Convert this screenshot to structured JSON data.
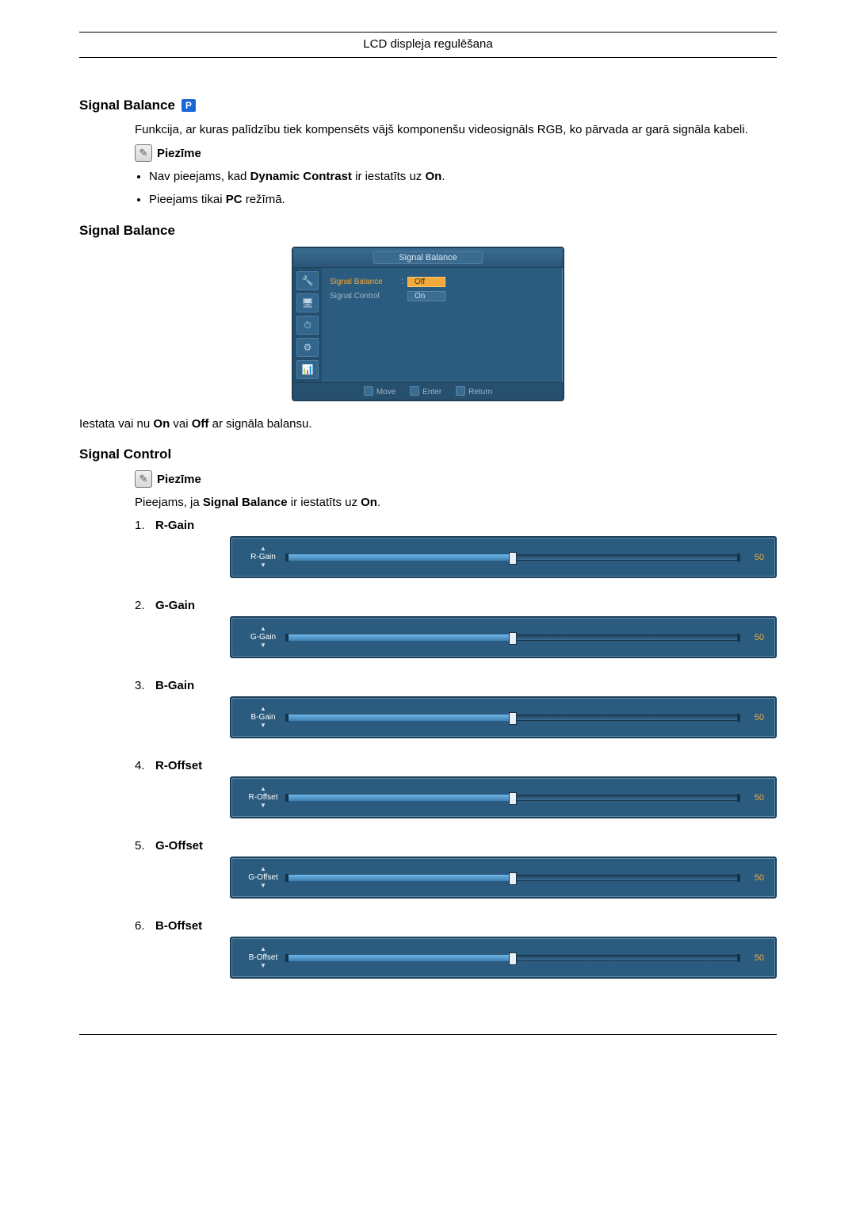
{
  "header": {
    "title": "LCD displeja regulēšana"
  },
  "sections": {
    "signal_balance_intro": {
      "heading": "Signal Balance",
      "pc_badge": "P",
      "description": "Funkcija, ar kuras palīdzību tiek kompensēts vājš komponenšu videosignāls RGB, ko pārvada ar garā signāla kabeli.",
      "note_label": "Piezīme",
      "bullets": [
        {
          "pre": "Nav pieejams, kad ",
          "bold": "Dynamic Contrast",
          "mid": " ir iestatīts uz ",
          "bold2": "On",
          "post": "."
        },
        {
          "pre": "Pieejams tikai ",
          "bold": "PC",
          "mid": " režīmā.",
          "bold2": "",
          "post": ""
        }
      ]
    },
    "signal_balance_menu": {
      "heading": "Signal Balance",
      "caption_pre": "Iestata vai nu ",
      "caption_b1": "On",
      "caption_mid": " vai ",
      "caption_b2": "Off",
      "caption_post": " ar signāla balansu."
    },
    "signal_control": {
      "heading": "Signal Control",
      "note_label": "Piezīme",
      "avail_pre": "Pieejams, ja ",
      "avail_b1": "Signal Balance",
      "avail_mid": " ir iestatīts uz ",
      "avail_b2": "On",
      "avail_post": "."
    }
  },
  "osd": {
    "title": "Signal Balance",
    "rows": [
      {
        "label": "Signal Balance",
        "value": "Off",
        "selected": true,
        "dim": false
      },
      {
        "label": "Signal Control",
        "value": "On",
        "selected": false,
        "dim": true
      }
    ],
    "footer": {
      "move": "Move",
      "enter": "Enter",
      "return": "Return"
    }
  },
  "sliders": [
    {
      "num": "1.",
      "name": "R-Gain",
      "value": "50"
    },
    {
      "num": "2.",
      "name": "G-Gain",
      "value": "50"
    },
    {
      "num": "3.",
      "name": "B-Gain",
      "value": "50"
    },
    {
      "num": "4.",
      "name": "R-Offset",
      "value": "50"
    },
    {
      "num": "5.",
      "name": "G-Offset",
      "value": "50"
    },
    {
      "num": "6.",
      "name": "B-Offset",
      "value": "50"
    }
  ]
}
